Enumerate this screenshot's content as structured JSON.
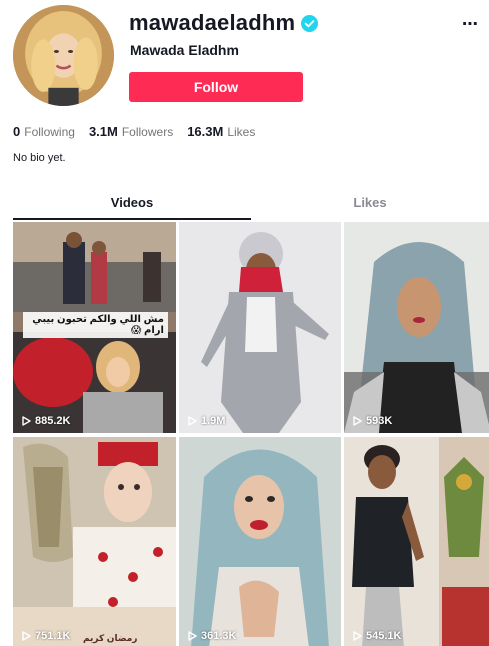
{
  "profile": {
    "username": "mawadaeladhm",
    "display_name": "Mawada Eladhm",
    "follow_label": "Follow",
    "more_label": "⋯",
    "bio": "No bio yet."
  },
  "stats": [
    {
      "value": "0",
      "label": "Following"
    },
    {
      "value": "3.1M",
      "label": "Followers"
    },
    {
      "value": "16.3M",
      "label": "Likes"
    }
  ],
  "tabs": [
    {
      "label": "Videos",
      "active": true
    },
    {
      "label": "Likes",
      "active": false
    }
  ],
  "videos": [
    {
      "views": "885.2K",
      "caption": "مش اللي والكم تحبون بيبي ارام 😱"
    },
    {
      "views": "1.9M"
    },
    {
      "views": "593K"
    },
    {
      "views": "751.1K",
      "stamp": "رمضان كريم"
    },
    {
      "views": "361.3K"
    },
    {
      "views": "545.1K"
    }
  ],
  "colors": {
    "follow": "#fe2c55",
    "verified": "#20d5ec",
    "text": "#161823",
    "muted": "#757575"
  },
  "icons": {
    "verified": "verified-badge-icon",
    "play": "play-icon",
    "more": "more-dots-icon"
  }
}
